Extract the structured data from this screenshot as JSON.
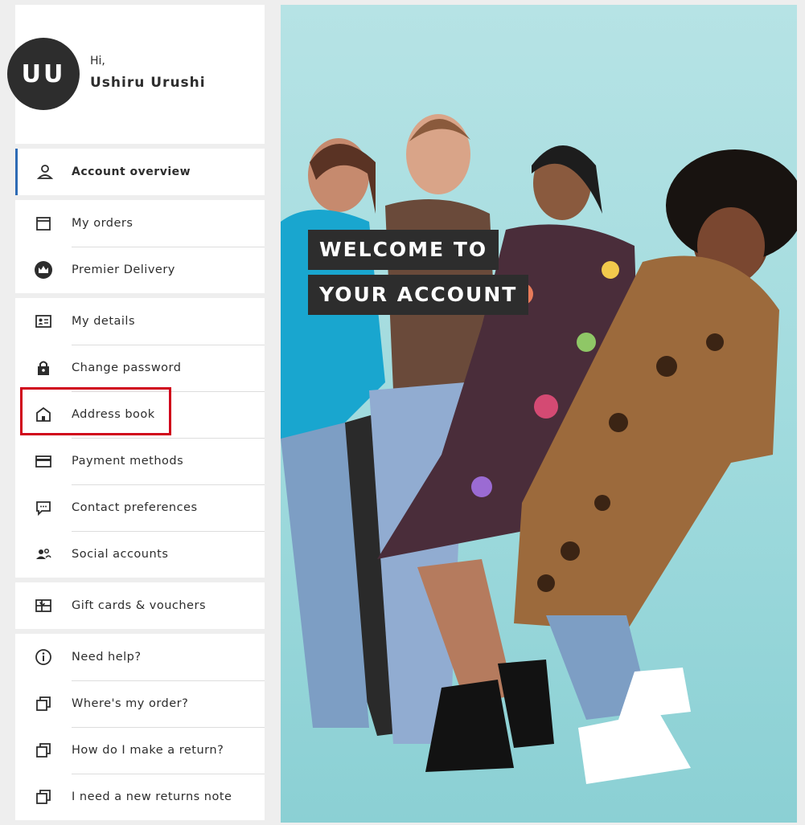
{
  "profile": {
    "initials": "UU",
    "greeting": "Hi,",
    "name": "Ushiru Urushi"
  },
  "menu_groups": [
    [
      {
        "id": "account-overview",
        "label": "Account overview",
        "icon": "person-icon"
      }
    ],
    [
      {
        "id": "my-orders",
        "label": "My orders",
        "icon": "package-icon"
      },
      {
        "id": "premier-delivery",
        "label": "Premier Delivery",
        "icon": "crown-icon"
      }
    ],
    [
      {
        "id": "my-details",
        "label": "My details",
        "icon": "id-card-icon"
      },
      {
        "id": "change-password",
        "label": "Change password",
        "icon": "lock-icon"
      },
      {
        "id": "address-book",
        "label": "Address book",
        "icon": "house-icon"
      },
      {
        "id": "payment-methods",
        "label": "Payment methods",
        "icon": "credit-card-icon"
      },
      {
        "id": "contact-preferences",
        "label": "Contact preferences",
        "icon": "chat-icon"
      },
      {
        "id": "social-accounts",
        "label": "Social accounts",
        "icon": "people-icon"
      }
    ],
    [
      {
        "id": "gift-cards",
        "label": "Gift cards & vouchers",
        "icon": "gift-card-icon"
      }
    ],
    [
      {
        "id": "need-help",
        "label": "Need help?",
        "icon": "info-icon"
      },
      {
        "id": "wheres-my-order",
        "label": "Where's my order?",
        "icon": "external-link-icon"
      },
      {
        "id": "make-a-return",
        "label": "How do I make a return?",
        "icon": "external-link-icon"
      },
      {
        "id": "returns-note",
        "label": "I need a new returns note",
        "icon": "external-link-icon"
      }
    ]
  ],
  "active_item": "account-overview",
  "highlighted_item": "address-book",
  "hero": {
    "line1": "WELCOME TO",
    "line2": "YOUR ACCOUNT"
  },
  "colors": {
    "accent": "#2d6bb5",
    "highlight": "#d0021b",
    "hero_background": "#a5dcdf",
    "dark": "#2d2d2d"
  }
}
